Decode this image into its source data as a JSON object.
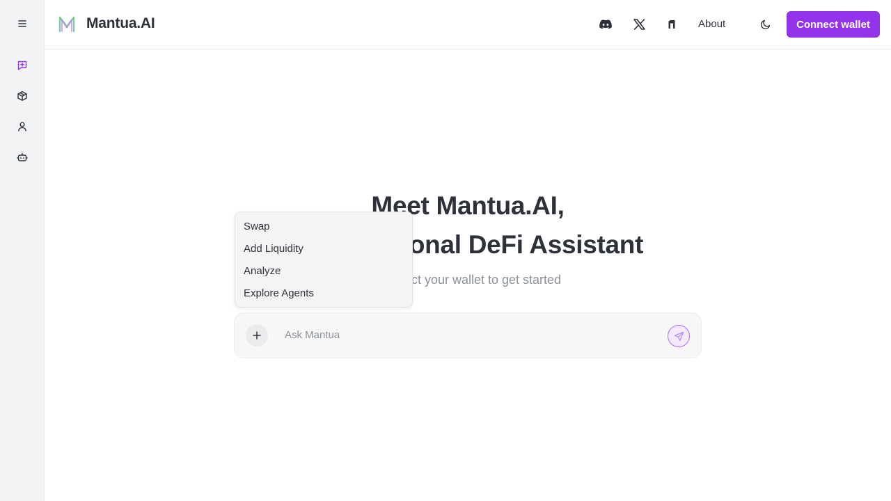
{
  "app": {
    "brand": "Mantua.AI"
  },
  "sidebar": {
    "items": [
      {
        "icon": "menu-icon"
      },
      {
        "icon": "chat-plus-icon"
      },
      {
        "icon": "cube-icon"
      },
      {
        "icon": "user-icon"
      },
      {
        "icon": "bot-icon"
      }
    ]
  },
  "header": {
    "about_label": "About",
    "connect_label": "Connect wallet",
    "icons": [
      "discord-icon",
      "x-icon",
      "docs-icon",
      "moon-icon"
    ]
  },
  "hero": {
    "line1": "Meet Mantua.AI,",
    "line2": "your Personal DeFi Assistant",
    "subtitle": "Connect your wallet to get started"
  },
  "chat": {
    "placeholder": "Ask Mantua"
  },
  "menu": {
    "items": [
      "Swap",
      "Add Liquidity",
      "Analyze",
      "Explore Agents"
    ]
  },
  "colors": {
    "accent": "#9333ea",
    "text": "#2d3139",
    "muted": "#8b9099"
  }
}
